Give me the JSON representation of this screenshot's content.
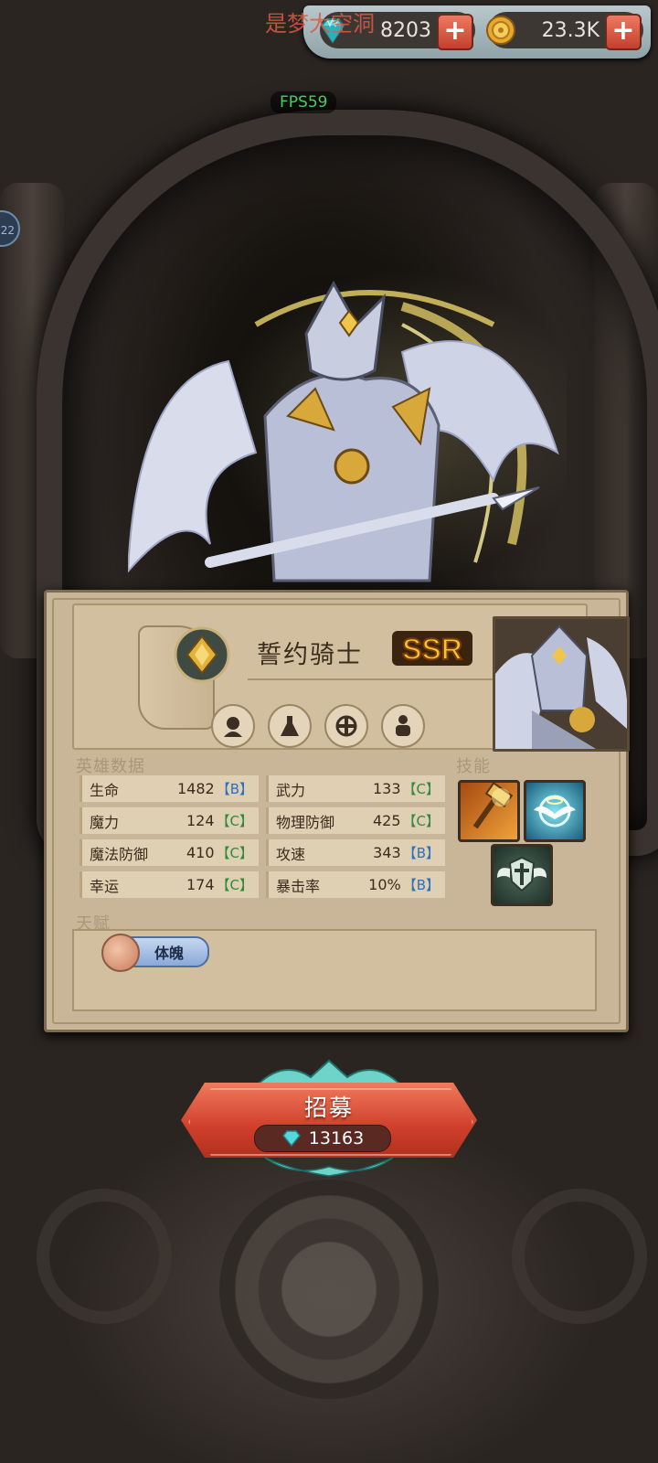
{
  "server_text": "是梦大空洞",
  "fps": "FPS59",
  "side_badge": "22",
  "resources": {
    "gems": "8203",
    "gold": "23.3K"
  },
  "hero": {
    "name": "誓约骑士",
    "rarity": "SSR"
  },
  "sections": {
    "hero_data": "英雄数据",
    "skills": "技能",
    "talent": "天赋"
  },
  "stats": [
    {
      "name": "生命",
      "value": "1482",
      "grade": "【B】",
      "tier": "B"
    },
    {
      "name": "武力",
      "value": "133",
      "grade": "【C】",
      "tier": "C"
    },
    {
      "name": "魔力",
      "value": "124",
      "grade": "【C】",
      "tier": "C"
    },
    {
      "name": "物理防御",
      "value": "425",
      "grade": "【C】",
      "tier": "C"
    },
    {
      "name": "魔法防御",
      "value": "410",
      "grade": "【C】",
      "tier": "C"
    },
    {
      "name": "攻速",
      "value": "343",
      "grade": "【B】",
      "tier": "B"
    },
    {
      "name": "幸运",
      "value": "174",
      "grade": "【C】",
      "tier": "C"
    },
    {
      "name": "暴击率",
      "value": "10%",
      "grade": "【B】",
      "tier": "B"
    }
  ],
  "talent": {
    "label": "体魄"
  },
  "recruit": {
    "label": "招募",
    "cost": "13163"
  },
  "colors": {
    "grade_b": "#2d6fc2",
    "grade_c": "#2f8b3a",
    "fps_green": "#3ed15f",
    "recruit_red": "#cf3f2b"
  }
}
